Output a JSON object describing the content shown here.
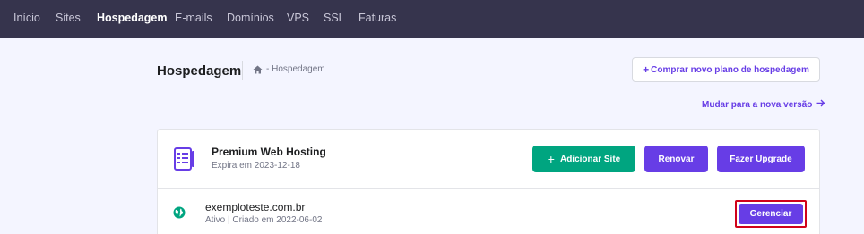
{
  "nav": {
    "items": [
      {
        "label": "Início"
      },
      {
        "label": "Sites"
      },
      {
        "label": "Hospedagem"
      },
      {
        "label": "E-mails"
      },
      {
        "label": "Domínios"
      },
      {
        "label": "VPS"
      },
      {
        "label": "SSL"
      },
      {
        "label": "Faturas"
      }
    ],
    "active": "Hospedagem"
  },
  "header": {
    "title": "Hospedagem",
    "breadcrumb": "- Hospedagem",
    "buy_button": "Comprar novo plano de hospedagem",
    "switch_link": "Mudar para a nova versão"
  },
  "plan": {
    "name": "Premium Web Hosting",
    "expiry": "Expira em 2023-12-18",
    "add_site_label": "Adicionar Site",
    "renew_label": "Renovar",
    "upgrade_label": "Fazer Upgrade"
  },
  "site": {
    "domain": "exemploteste.com.br",
    "status": "Ativo | Criado em 2022-06-02",
    "manage_label": "Gerenciar"
  },
  "colors": {
    "nav_bg": "#36344d",
    "accent": "#673de6",
    "success": "#00a580",
    "highlight": "#d0021b"
  },
  "icons": [
    "home-icon",
    "plus-icon",
    "arrow-right-icon",
    "server-list-icon",
    "globe-icon"
  ]
}
